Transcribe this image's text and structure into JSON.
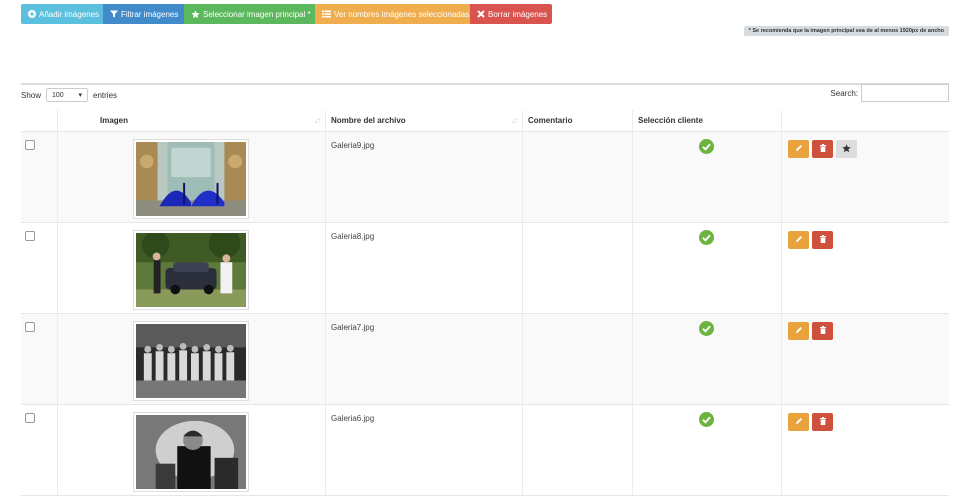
{
  "toolbar": {
    "add_images": "Añadir imágenes",
    "filter_images": "Filtrar imágenes",
    "select_main": "Seleccionar imagen principal *",
    "view_names": "Ver nombres imágenes seleccionadas",
    "delete_images": "Borrar imágenes"
  },
  "note": "* Se recomienda que la imagen principal sea de al menos 1920px de ancho",
  "table_controls": {
    "show_label": "Show",
    "page_size": "100",
    "entries_label": "entries",
    "search_label": "Search:",
    "search_value": ""
  },
  "columns": [
    "Imagen",
    "Nombre del archivo",
    "Comentario",
    "Selección cliente"
  ],
  "rows": [
    {
      "filename": "Galeria9.jpg",
      "comment": "",
      "client_selected": true,
      "is_main_candidate": true,
      "thumb": "blue-shoes"
    },
    {
      "filename": "Galeria8.jpg",
      "comment": "",
      "client_selected": true,
      "is_main_candidate": false,
      "thumb": "couple-classic-car"
    },
    {
      "filename": "Galeria7.jpg",
      "comment": "",
      "client_selected": true,
      "is_main_candidate": false,
      "thumb": "groomsmen-bw"
    },
    {
      "filename": "Galeria6.jpg",
      "comment": "",
      "client_selected": true,
      "is_main_candidate": false,
      "thumb": "man-portrait-bw"
    }
  ],
  "colors": {
    "info": "#5bc0de",
    "primary": "#428bca",
    "success": "#5cb85c",
    "warning": "#f0ad4e",
    "danger": "#d9534f",
    "check": "#6cb33f"
  },
  "icons": {
    "add": "plus-circle-icon",
    "filter": "filter-icon",
    "select": "star-icon",
    "view": "list-icon",
    "delete": "times-icon",
    "edit": "pencil-icon",
    "trash": "trash-icon",
    "main": "star-icon",
    "selected": "check-circle-icon"
  }
}
